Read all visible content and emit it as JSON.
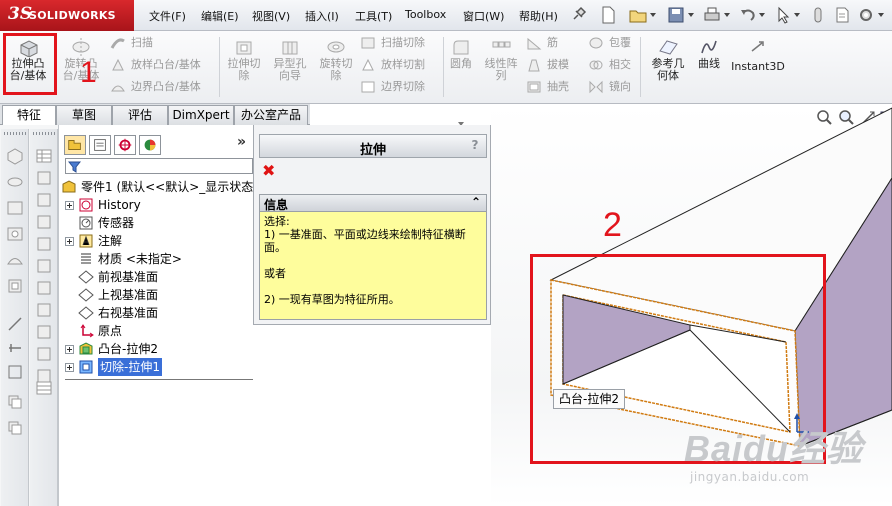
{
  "app": {
    "logo_ds": "3S",
    "logo_name": "SOLIDWORKS"
  },
  "menu": [
    {
      "label": "文件(F)"
    },
    {
      "label": "编辑(E)"
    },
    {
      "label": "视图(V)"
    },
    {
      "label": "插入(I)"
    },
    {
      "label": "工具(T)"
    },
    {
      "label": "Toolbox"
    },
    {
      "label": "窗口(W)"
    },
    {
      "label": "帮助(H)"
    }
  ],
  "commands": {
    "extrude_boss": "拉伸凸\n台/基体",
    "revolve_boss": "旋转凸\n台/基体",
    "sweep": "扫描",
    "loft": "放样凸台/基体",
    "boundary": "边界凸台/基体",
    "extrude_cut": "拉伸切\n除",
    "hole_wizard": "异型孔\n向导",
    "revolve_cut": "旋转切\n除",
    "swept_cut": "扫描切除",
    "lofted_cut": "放样切割",
    "boundary_cut": "边界切除",
    "fillet": "圆角",
    "linear_pattern": "线性阵\n列",
    "rib": "筋",
    "draft": "拔模",
    "shell": "抽壳",
    "wrap": "包覆",
    "intersect": "相交",
    "mirror": "镜向",
    "ref_geometry": "参考几\n何体",
    "curves": "曲线",
    "instant3d": "Instant3D"
  },
  "callouts": {
    "one": "1",
    "two": "2"
  },
  "tabs": [
    {
      "label": "特征"
    },
    {
      "label": "草图"
    },
    {
      "label": "评估"
    },
    {
      "label": "DimXpert"
    },
    {
      "label": "办公室产品"
    }
  ],
  "feature_tree": {
    "more": "»",
    "part": "零件1 (默认<<默认>_显示状态",
    "items": [
      {
        "label": "History"
      },
      {
        "label": "传感器"
      },
      {
        "label": "注解"
      },
      {
        "label": "材质 <未指定>"
      },
      {
        "label": "前视基准面"
      },
      {
        "label": "上视基准面"
      },
      {
        "label": "右视基准面"
      },
      {
        "label": "原点"
      },
      {
        "label": "凸台-拉伸2"
      },
      {
        "label": "切除-拉伸1"
      }
    ]
  },
  "property_manager": {
    "title": "拉伸",
    "help": "?",
    "close": "✖",
    "info_header": "信息",
    "info_collapse": "⌃",
    "info_line1": "选择:",
    "info_line2": "1) 一基准面、平面或边线来绘制特征横断面。",
    "info_line3": "或者",
    "info_line4": "2) 一现有草图为特征所用。"
  },
  "tooltip": "凸台-拉伸2",
  "watermark": {
    "main": "Baidu经验",
    "sub": "jingyan.baidu.com"
  },
  "colors": {
    "callout": "#e2141c",
    "info_bg": "#fefd9c",
    "cut_face": "#b3a3c4",
    "edge_highlight": "#d07a10"
  }
}
